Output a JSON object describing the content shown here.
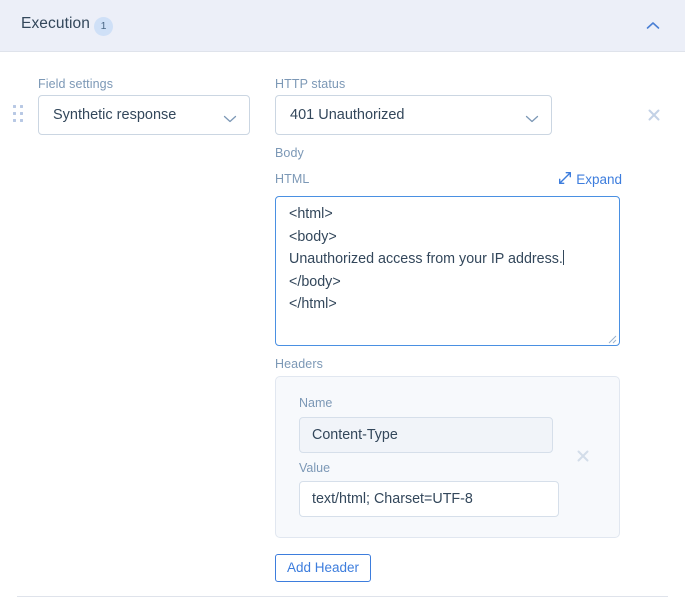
{
  "section": {
    "title": "Execution",
    "badge_count": "1",
    "collapse_icon": "chevron-up-icon",
    "accent_color": "#3d7ddd",
    "header_bg": "#eceff8"
  },
  "field_settings": {
    "label": "Field settings",
    "selected": "Synthetic response",
    "chevron_icon": "chevron-down-icon",
    "drag_icon": "drag-handle-icon"
  },
  "http_status": {
    "label": "HTTP status",
    "selected": "401 Unauthorized",
    "chevron_icon": "chevron-down-icon"
  },
  "body": {
    "label": "Body",
    "format_label": "HTML",
    "expand_label": "Expand",
    "expand_icon": "expand-diagonal-arrows-icon",
    "code_lines": [
      "<html>",
      "<body>",
      "Unauthorized access from your IP address.",
      "</body>",
      "</html>"
    ],
    "resize_icon": "resize-grip-icon"
  },
  "headers": {
    "label": "Headers",
    "name_label": "Name",
    "name_value": "Content-Type",
    "value_label": "Value",
    "value_value": "text/html; Charset=UTF-8",
    "remove_icon": "close-x-icon",
    "add_button_label": "Add Header"
  },
  "execution_remove": {
    "remove_icon": "close-x-icon"
  }
}
